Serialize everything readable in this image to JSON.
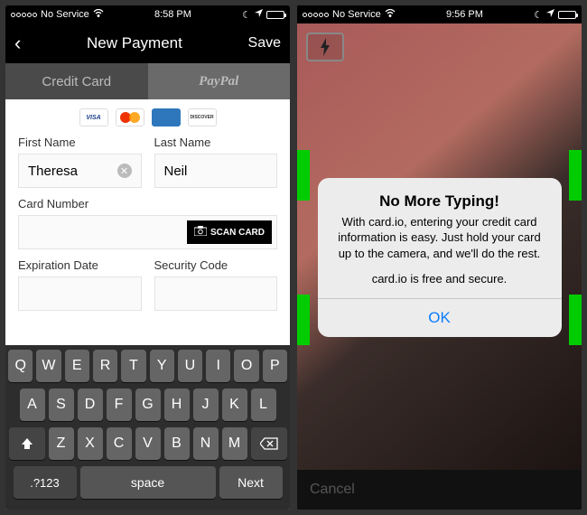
{
  "left": {
    "status": {
      "carrier": "No Service",
      "time": "8:58 PM"
    },
    "nav": {
      "title": "New Payment",
      "save": "Save"
    },
    "tabs": {
      "credit": "Credit Card",
      "paypal": "PayPal"
    },
    "cards": {
      "visa": "VISA",
      "amex": "AMEX",
      "discover": "DISCOVER"
    },
    "form": {
      "first_label": "First Name",
      "first_value": "Theresa",
      "last_label": "Last Name",
      "last_value": "Neil",
      "card_label": "Card Number",
      "scan": "SCAN CARD",
      "exp_label": "Expiration Date",
      "sec_label": "Security Code"
    },
    "keyboard": {
      "row1": [
        "Q",
        "W",
        "E",
        "R",
        "T",
        "Y",
        "U",
        "I",
        "O",
        "P"
      ],
      "row2": [
        "A",
        "S",
        "D",
        "F",
        "G",
        "H",
        "J",
        "K",
        "L"
      ],
      "row3": [
        "Z",
        "X",
        "C",
        "V",
        "B",
        "N",
        "M"
      ],
      "numsym": ".?123",
      "space": "space",
      "next": "Next"
    }
  },
  "right": {
    "status": {
      "carrier": "No Service",
      "time": "9:56 PM"
    },
    "alert": {
      "title": "No More Typing!",
      "body": "With card.io, entering your credit card information is easy. Just hold your card up to the camera, and we'll do the rest.",
      "body2": "card.io is free and secure.",
      "ok": "OK"
    },
    "cancel": "Cancel"
  }
}
